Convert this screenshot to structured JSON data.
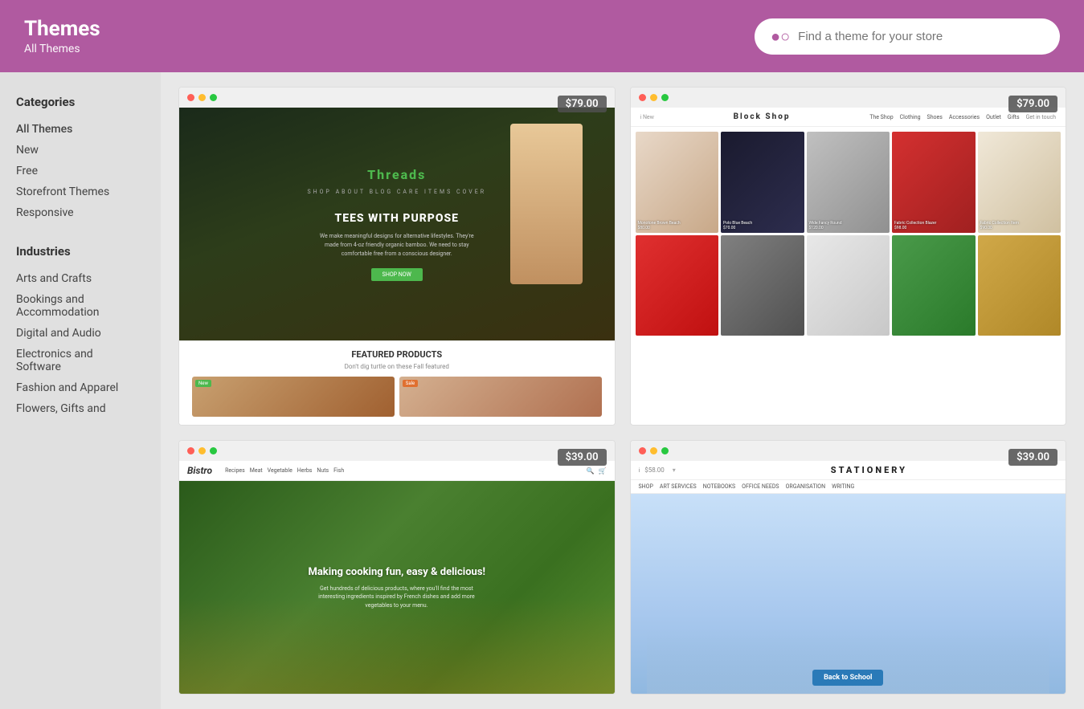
{
  "header": {
    "title": "Themes",
    "subtitle": "All Themes",
    "search_placeholder": "Find a theme for your store"
  },
  "sidebar": {
    "categories_label": "Categories",
    "industries_label": "Industries",
    "category_items": [
      {
        "id": "all-themes",
        "label": "All Themes",
        "active": true
      },
      {
        "id": "new",
        "label": "New"
      },
      {
        "id": "free",
        "label": "Free"
      },
      {
        "id": "storefront-themes",
        "label": "Storefront Themes"
      },
      {
        "id": "responsive",
        "label": "Responsive"
      }
    ],
    "industry_items": [
      {
        "id": "arts-and-crafts",
        "label": "Arts and Crafts"
      },
      {
        "id": "bookings-and-accommodation",
        "label": "Bookings and Accommodation"
      },
      {
        "id": "digital-and-audio",
        "label": "Digital and Audio"
      },
      {
        "id": "electronics-and-software",
        "label": "Electronics and Software"
      },
      {
        "id": "fashion-and-apparel",
        "label": "Fashion and Apparel"
      },
      {
        "id": "flowers-gifts-and",
        "label": "Flowers, Gifts and"
      }
    ]
  },
  "themes": [
    {
      "id": "threads",
      "price": "$79.00",
      "name": "Threads",
      "nav_text": "SHOP  ABOUT  BLOG  CARE ITEMS  COVER",
      "hero_text": "TEES WITH PURPOSE",
      "sub_text": "We make meaningful designs for alternative lifestyles. They're made from 4-oz friendly organic bamboo. We need to stay comfortable free from a conscious designer.",
      "btn_text": "SHOP NOW",
      "featured_title": "FEATURED PRODUCTS",
      "featured_sub": "Don't dig turtle on these Fall featured",
      "badge1": "New",
      "badge2": "Sale"
    },
    {
      "id": "blockshop",
      "price": "$79.00",
      "name": "Block Shop",
      "nav_items": [
        "The Shop",
        "Clothing",
        "Shoes",
        "Accessories",
        "Outlet",
        "Gifts"
      ]
    },
    {
      "id": "bistro",
      "price": "$39.00",
      "name": "Bistro",
      "logo": "Bistro",
      "nav_items": [
        "Recipes",
        "Meat",
        "Vegetable",
        "Herbs",
        "Nuts",
        "Fish"
      ],
      "hero_text": "Making cooking fun, easy & delicious!",
      "hero_sub": "Get hundreds of delicious products, where you'll find the most interesting ingredients inspired by French dishes and add more vegetables to your menu."
    },
    {
      "id": "stationery",
      "price": "$39.00",
      "name": "Stationery",
      "logo": "STATIONERY",
      "nav_items": [
        "SHOP",
        "ART SERVICES",
        "NOTEBOOKS",
        "OFFICE NEEDS",
        "ORGANISATION",
        "WRITING"
      ],
      "badge_text": "Back to School"
    }
  ]
}
